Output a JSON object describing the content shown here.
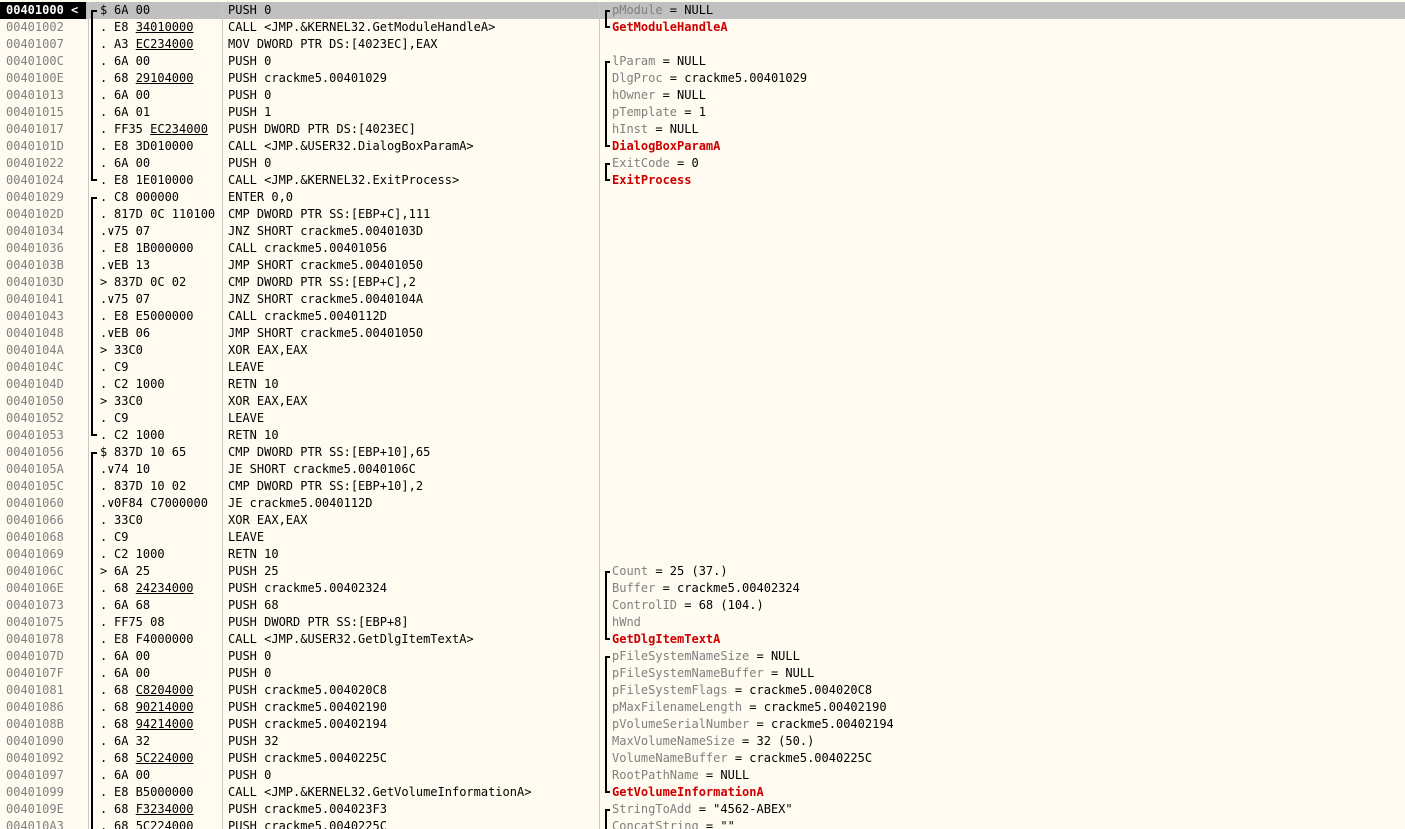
{
  "rows": [
    {
      "addr": "00401000",
      "mark": "$",
      "hex": "6A 00",
      "hex_ul": "",
      "asm": "PUSH 0",
      "com_name": "pModule",
      "com_val": " = NULL",
      "api": false,
      "selected": true
    },
    {
      "addr": "00401002",
      "mark": ".",
      "hex": "E8 ",
      "hex_ul": "34010000",
      "asm": "CALL <JMP.&KERNEL32.GetModuleHandleA>",
      "com_name": "GetModuleHandleA",
      "com_val": "",
      "api": true
    },
    {
      "addr": "00401007",
      "mark": ".",
      "hex": "A3 ",
      "hex_ul": "EC234000",
      "asm": "MOV DWORD PTR DS:[4023EC],EAX",
      "com_name": "",
      "com_val": "",
      "api": false
    },
    {
      "addr": "0040100C",
      "mark": ".",
      "hex": "6A 00",
      "hex_ul": "",
      "asm": "PUSH 0",
      "com_name": "lParam",
      "com_val": " = NULL",
      "api": false
    },
    {
      "addr": "0040100E",
      "mark": ".",
      "hex": "68 ",
      "hex_ul": "29104000",
      "asm": "PUSH crackme5.00401029",
      "com_name": "DlgProc",
      "com_val": " = crackme5.00401029",
      "api": false
    },
    {
      "addr": "00401013",
      "mark": ".",
      "hex": "6A 00",
      "hex_ul": "",
      "asm": "PUSH 0",
      "com_name": "hOwner",
      "com_val": " = NULL",
      "api": false
    },
    {
      "addr": "00401015",
      "mark": ".",
      "hex": "6A 01",
      "hex_ul": "",
      "asm": "PUSH 1",
      "com_name": "pTemplate",
      "com_val": " = 1",
      "api": false
    },
    {
      "addr": "00401017",
      "mark": ".",
      "hex": "FF35 ",
      "hex_ul": "EC234000",
      "asm": "PUSH DWORD PTR DS:[4023EC]",
      "com_name": "hInst",
      "com_val": " = NULL",
      "api": false
    },
    {
      "addr": "0040101D",
      "mark": ".",
      "hex": "E8 3D010000",
      "hex_ul": "",
      "asm": "CALL <JMP.&USER32.DialogBoxParamA>",
      "com_name": "DialogBoxParamA",
      "com_val": "",
      "api": true
    },
    {
      "addr": "00401022",
      "mark": ".",
      "hex": "6A 00",
      "hex_ul": "",
      "asm": "PUSH 0",
      "com_name": "ExitCode",
      "com_val": " = 0",
      "api": false
    },
    {
      "addr": "00401024",
      "mark": ".",
      "hex": "E8 1E010000",
      "hex_ul": "",
      "asm": "CALL <JMP.&KERNEL32.ExitProcess>",
      "com_name": "ExitProcess",
      "com_val": "",
      "api": true
    },
    {
      "addr": "00401029",
      "mark": ".",
      "hex": "C8 000000",
      "hex_ul": "",
      "asm": "ENTER 0,0",
      "com_name": "",
      "com_val": "",
      "api": false
    },
    {
      "addr": "0040102D",
      "mark": ".",
      "hex": "817D 0C 110100",
      "hex_ul": "",
      "asm": "CMP DWORD PTR SS:[EBP+C],111",
      "com_name": "",
      "com_val": "",
      "api": false
    },
    {
      "addr": "00401034",
      "mark": ".∨",
      "hex": "75 07",
      "hex_ul": "",
      "asm": "JNZ SHORT crackme5.0040103D",
      "com_name": "",
      "com_val": "",
      "api": false
    },
    {
      "addr": "00401036",
      "mark": ".",
      "hex": "E8 1B000000",
      "hex_ul": "",
      "asm": "CALL crackme5.00401056",
      "com_name": "",
      "com_val": "",
      "api": false
    },
    {
      "addr": "0040103B",
      "mark": ".∨",
      "hex": "EB 13",
      "hex_ul": "",
      "asm": "JMP SHORT crackme5.00401050",
      "com_name": "",
      "com_val": "",
      "api": false
    },
    {
      "addr": "0040103D",
      "mark": ">",
      "hex": "837D 0C 02",
      "hex_ul": "",
      "asm": "CMP DWORD PTR SS:[EBP+C],2",
      "com_name": "",
      "com_val": "",
      "api": false
    },
    {
      "addr": "00401041",
      "mark": ".∨",
      "hex": "75 07",
      "hex_ul": "",
      "asm": "JNZ SHORT crackme5.0040104A",
      "com_name": "",
      "com_val": "",
      "api": false
    },
    {
      "addr": "00401043",
      "mark": ".",
      "hex": "E8 E5000000",
      "hex_ul": "",
      "asm": "CALL crackme5.0040112D",
      "com_name": "",
      "com_val": "",
      "api": false
    },
    {
      "addr": "00401048",
      "mark": ".∨",
      "hex": "EB 06",
      "hex_ul": "",
      "asm": "JMP SHORT crackme5.00401050",
      "com_name": "",
      "com_val": "",
      "api": false
    },
    {
      "addr": "0040104A",
      "mark": ">",
      "hex": "33C0",
      "hex_ul": "",
      "asm": "XOR EAX,EAX",
      "com_name": "",
      "com_val": "",
      "api": false
    },
    {
      "addr": "0040104C",
      "mark": ".",
      "hex": "C9",
      "hex_ul": "",
      "asm": "LEAVE",
      "com_name": "",
      "com_val": "",
      "api": false
    },
    {
      "addr": "0040104D",
      "mark": ".",
      "hex": "C2 1000",
      "hex_ul": "",
      "asm": "RETN 10",
      "com_name": "",
      "com_val": "",
      "api": false
    },
    {
      "addr": "00401050",
      "mark": ">",
      "hex": "33C0",
      "hex_ul": "",
      "asm": "XOR EAX,EAX",
      "com_name": "",
      "com_val": "",
      "api": false
    },
    {
      "addr": "00401052",
      "mark": ".",
      "hex": "C9",
      "hex_ul": "",
      "asm": "LEAVE",
      "com_name": "",
      "com_val": "",
      "api": false
    },
    {
      "addr": "00401053",
      "mark": ".",
      "hex": "C2 1000",
      "hex_ul": "",
      "asm": "RETN 10",
      "com_name": "",
      "com_val": "",
      "api": false
    },
    {
      "addr": "00401056",
      "mark": "$",
      "hex": "837D 10 65",
      "hex_ul": "",
      "asm": "CMP DWORD PTR SS:[EBP+10],65",
      "com_name": "",
      "com_val": "",
      "api": false
    },
    {
      "addr": "0040105A",
      "mark": ".∨",
      "hex": "74 10",
      "hex_ul": "",
      "asm": "JE SHORT crackme5.0040106C",
      "com_name": "",
      "com_val": "",
      "api": false
    },
    {
      "addr": "0040105C",
      "mark": ".",
      "hex": "837D 10 02",
      "hex_ul": "",
      "asm": "CMP DWORD PTR SS:[EBP+10],2",
      "com_name": "",
      "com_val": "",
      "api": false
    },
    {
      "addr": "00401060",
      "mark": ".∨",
      "hex": "0F84 C7000000",
      "hex_ul": "",
      "asm": "JE crackme5.0040112D",
      "com_name": "",
      "com_val": "",
      "api": false
    },
    {
      "addr": "00401066",
      "mark": ".",
      "hex": "33C0",
      "hex_ul": "",
      "asm": "XOR EAX,EAX",
      "com_name": "",
      "com_val": "",
      "api": false
    },
    {
      "addr": "00401068",
      "mark": ".",
      "hex": "C9",
      "hex_ul": "",
      "asm": "LEAVE",
      "com_name": "",
      "com_val": "",
      "api": false
    },
    {
      "addr": "00401069",
      "mark": ".",
      "hex": "C2 1000",
      "hex_ul": "",
      "asm": "RETN 10",
      "com_name": "",
      "com_val": "",
      "api": false
    },
    {
      "addr": "0040106C",
      "mark": ">",
      "hex": "6A 25",
      "hex_ul": "",
      "asm": "PUSH 25",
      "com_name": "Count",
      "com_val": " = 25 (37.)",
      "api": false
    },
    {
      "addr": "0040106E",
      "mark": ".",
      "hex": "68 ",
      "hex_ul": "24234000",
      "asm": "PUSH crackme5.00402324",
      "com_name": "Buffer",
      "com_val": " = crackme5.00402324",
      "api": false
    },
    {
      "addr": "00401073",
      "mark": ".",
      "hex": "6A 68",
      "hex_ul": "",
      "asm": "PUSH 68",
      "com_name": "ControlID",
      "com_val": " = 68 (104.)",
      "api": false
    },
    {
      "addr": "00401075",
      "mark": ".",
      "hex": "FF75 08",
      "hex_ul": "",
      "asm": "PUSH DWORD PTR SS:[EBP+8]",
      "com_name": "hWnd",
      "com_val": "",
      "api": false
    },
    {
      "addr": "00401078",
      "mark": ".",
      "hex": "E8 F4000000",
      "hex_ul": "",
      "asm": "CALL <JMP.&USER32.GetDlgItemTextA>",
      "com_name": "GetDlgItemTextA",
      "com_val": "",
      "api": true
    },
    {
      "addr": "0040107D",
      "mark": ".",
      "hex": "6A 00",
      "hex_ul": "",
      "asm": "PUSH 0",
      "com_name": "pFileSystemNameSize",
      "com_val": " = NULL",
      "api": false
    },
    {
      "addr": "0040107F",
      "mark": ".",
      "hex": "6A 00",
      "hex_ul": "",
      "asm": "PUSH 0",
      "com_name": "pFileSystemNameBuffer",
      "com_val": " = NULL",
      "api": false
    },
    {
      "addr": "00401081",
      "mark": ".",
      "hex": "68 ",
      "hex_ul": "C8204000",
      "asm": "PUSH crackme5.004020C8",
      "com_name": "pFileSystemFlags",
      "com_val": " = crackme5.004020C8",
      "api": false
    },
    {
      "addr": "00401086",
      "mark": ".",
      "hex": "68 ",
      "hex_ul": "90214000",
      "asm": "PUSH crackme5.00402190",
      "com_name": "pMaxFilenameLength",
      "com_val": " = crackme5.00402190",
      "api": false
    },
    {
      "addr": "0040108B",
      "mark": ".",
      "hex": "68 ",
      "hex_ul": "94214000",
      "asm": "PUSH crackme5.00402194",
      "com_name": "pVolumeSerialNumber",
      "com_val": " = crackme5.00402194",
      "api": false
    },
    {
      "addr": "00401090",
      "mark": ".",
      "hex": "6A 32",
      "hex_ul": "",
      "asm": "PUSH 32",
      "com_name": "MaxVolumeNameSize",
      "com_val": " = 32 (50.)",
      "api": false
    },
    {
      "addr": "00401092",
      "mark": ".",
      "hex": "68 ",
      "hex_ul": "5C224000",
      "asm": "PUSH crackme5.0040225C",
      "com_name": "VolumeNameBuffer",
      "com_val": " = crackme5.0040225C",
      "api": false
    },
    {
      "addr": "00401097",
      "mark": ".",
      "hex": "6A 00",
      "hex_ul": "",
      "asm": "PUSH 0",
      "com_name": "RootPathName",
      "com_val": " = NULL",
      "api": false
    },
    {
      "addr": "00401099",
      "mark": ".",
      "hex": "E8 B5000000",
      "hex_ul": "",
      "asm": "CALL <JMP.&KERNEL32.GetVolumeInformationA>",
      "com_name": "GetVolumeInformationA",
      "com_val": "",
      "api": true
    },
    {
      "addr": "0040109E",
      "mark": ".",
      "hex": "68 ",
      "hex_ul": "F3234000",
      "asm": "PUSH crackme5.004023F3",
      "com_name": "StringToAdd",
      "com_val": " = \"4562-ABEX\"",
      "api": false
    },
    {
      "addr": "004010A3",
      "mark": ".",
      "hex": "68 ",
      "hex_ul": "5C224000",
      "asm": "PUSH crackme5.0040225C",
      "com_name": "ConcatString",
      "com_val": " = \"\"",
      "api": false
    }
  ]
}
